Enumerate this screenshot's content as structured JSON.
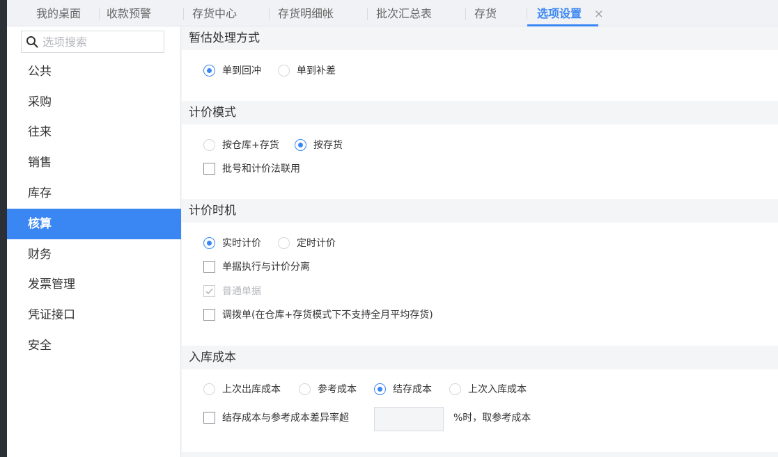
{
  "tabs": [
    {
      "label": "我的桌面"
    },
    {
      "label": "收款预警"
    },
    {
      "label": "存货中心"
    },
    {
      "label": "存货明细帐"
    },
    {
      "label": "批次汇总表"
    },
    {
      "label": "存货"
    },
    {
      "label": "选项设置",
      "active": true,
      "close": "×"
    }
  ],
  "sidebar": {
    "search_placeholder": "选项搜索",
    "items": [
      {
        "label": "公共"
      },
      {
        "label": "采购"
      },
      {
        "label": "往来"
      },
      {
        "label": "销售"
      },
      {
        "label": "库存"
      },
      {
        "label": "核算",
        "active": true
      },
      {
        "label": "财务"
      },
      {
        "label": "发票管理"
      },
      {
        "label": "凭证接口"
      },
      {
        "label": "安全"
      }
    ]
  },
  "sections": {
    "estimate": {
      "title": "暂估处理方式",
      "options": [
        {
          "label": "单到回冲",
          "checked": true
        },
        {
          "label": "单到补差",
          "checked": false
        }
      ]
    },
    "pricing_mode": {
      "title": "计价模式",
      "options": [
        {
          "label": "按仓库+存货",
          "checked": false
        },
        {
          "label": "按存货",
          "checked": true
        }
      ],
      "batch_link": {
        "label": "批号和计价法联用",
        "checked": false
      }
    },
    "pricing_timing": {
      "title": "计价时机",
      "options": [
        {
          "label": "实时计价",
          "checked": true
        },
        {
          "label": "定时计价",
          "checked": false
        }
      ],
      "separate": {
        "label": "单据执行与计价分离",
        "checked": false
      },
      "normal_doc": {
        "label": "普通单据",
        "checked": true,
        "disabled": true
      },
      "transfer": {
        "label": "调拨单(在仓库+存货模式下不支持全月平均存货)",
        "checked": false
      }
    },
    "inbound_cost": {
      "title": "入库成本",
      "options": [
        {
          "label": "上次出库成本",
          "checked": false
        },
        {
          "label": "参考成本",
          "checked": false
        },
        {
          "label": "结存成本",
          "checked": true
        },
        {
          "label": "上次入库成本",
          "checked": false
        }
      ],
      "diff_rate": {
        "label": "结存成本与参考成本差异率超",
        "checked": false,
        "value": "",
        "suffix": "%时，取参考成本"
      }
    }
  },
  "colors": {
    "accent": "#3a86f3",
    "sidebar_dark": "#2b2f36",
    "section_bg": "#f4f5f7"
  }
}
